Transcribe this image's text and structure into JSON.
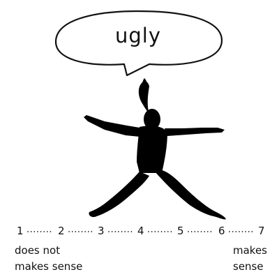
{
  "speech_bubble": {
    "word": "ugly"
  },
  "scale": {
    "points": [
      "1",
      "2",
      "3",
      "4",
      "5",
      "6",
      "7"
    ],
    "separator": "........"
  },
  "anchors": {
    "left": {
      "line1": "does not",
      "line2": "makes sense"
    },
    "right": {
      "line1": "makes",
      "line2": "sense"
    }
  },
  "colors": {
    "ink": "#111111",
    "silhouette": "#000000",
    "background": "#ffffff"
  }
}
